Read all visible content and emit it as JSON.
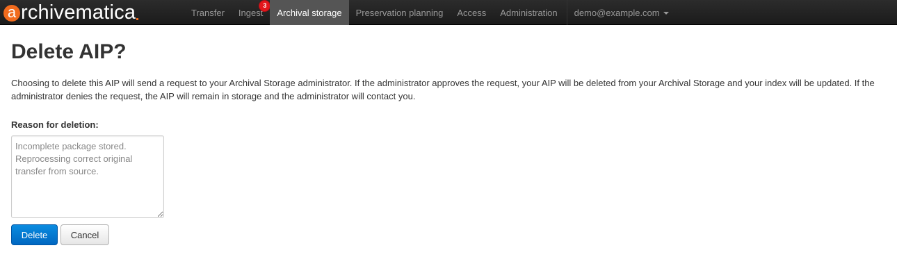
{
  "navbar": {
    "brand": {
      "letter": "a",
      "rest": "rchivematica"
    },
    "items": [
      {
        "label": "Transfer",
        "active": false
      },
      {
        "label": "Ingest",
        "active": false,
        "badge": "3"
      },
      {
        "label": "Archival storage",
        "active": true
      },
      {
        "label": "Preservation planning",
        "active": false
      },
      {
        "label": "Access",
        "active": false
      },
      {
        "label": "Administration",
        "active": false
      }
    ],
    "user": "demo@example.com"
  },
  "page": {
    "title": "Delete AIP?",
    "description": "Choosing to delete this AIP will send a request to your Archival Storage administrator. If the administrator approves the request, your AIP will be deleted from your Archival Storage and your index will be updated. If the administrator denies the request, the AIP will remain in storage and the administrator will contact you.",
    "reason_label": "Reason for deletion:",
    "reason_placeholder": "Incomplete package stored. Reprocessing correct original transfer from source.",
    "delete_label": "Delete",
    "cancel_label": "Cancel"
  },
  "colors": {
    "navbar_bg": "#1b1b1b",
    "brand_accent": "#f26b1d",
    "primary_button": "#0a7cd4",
    "badge": "#e3161c"
  }
}
